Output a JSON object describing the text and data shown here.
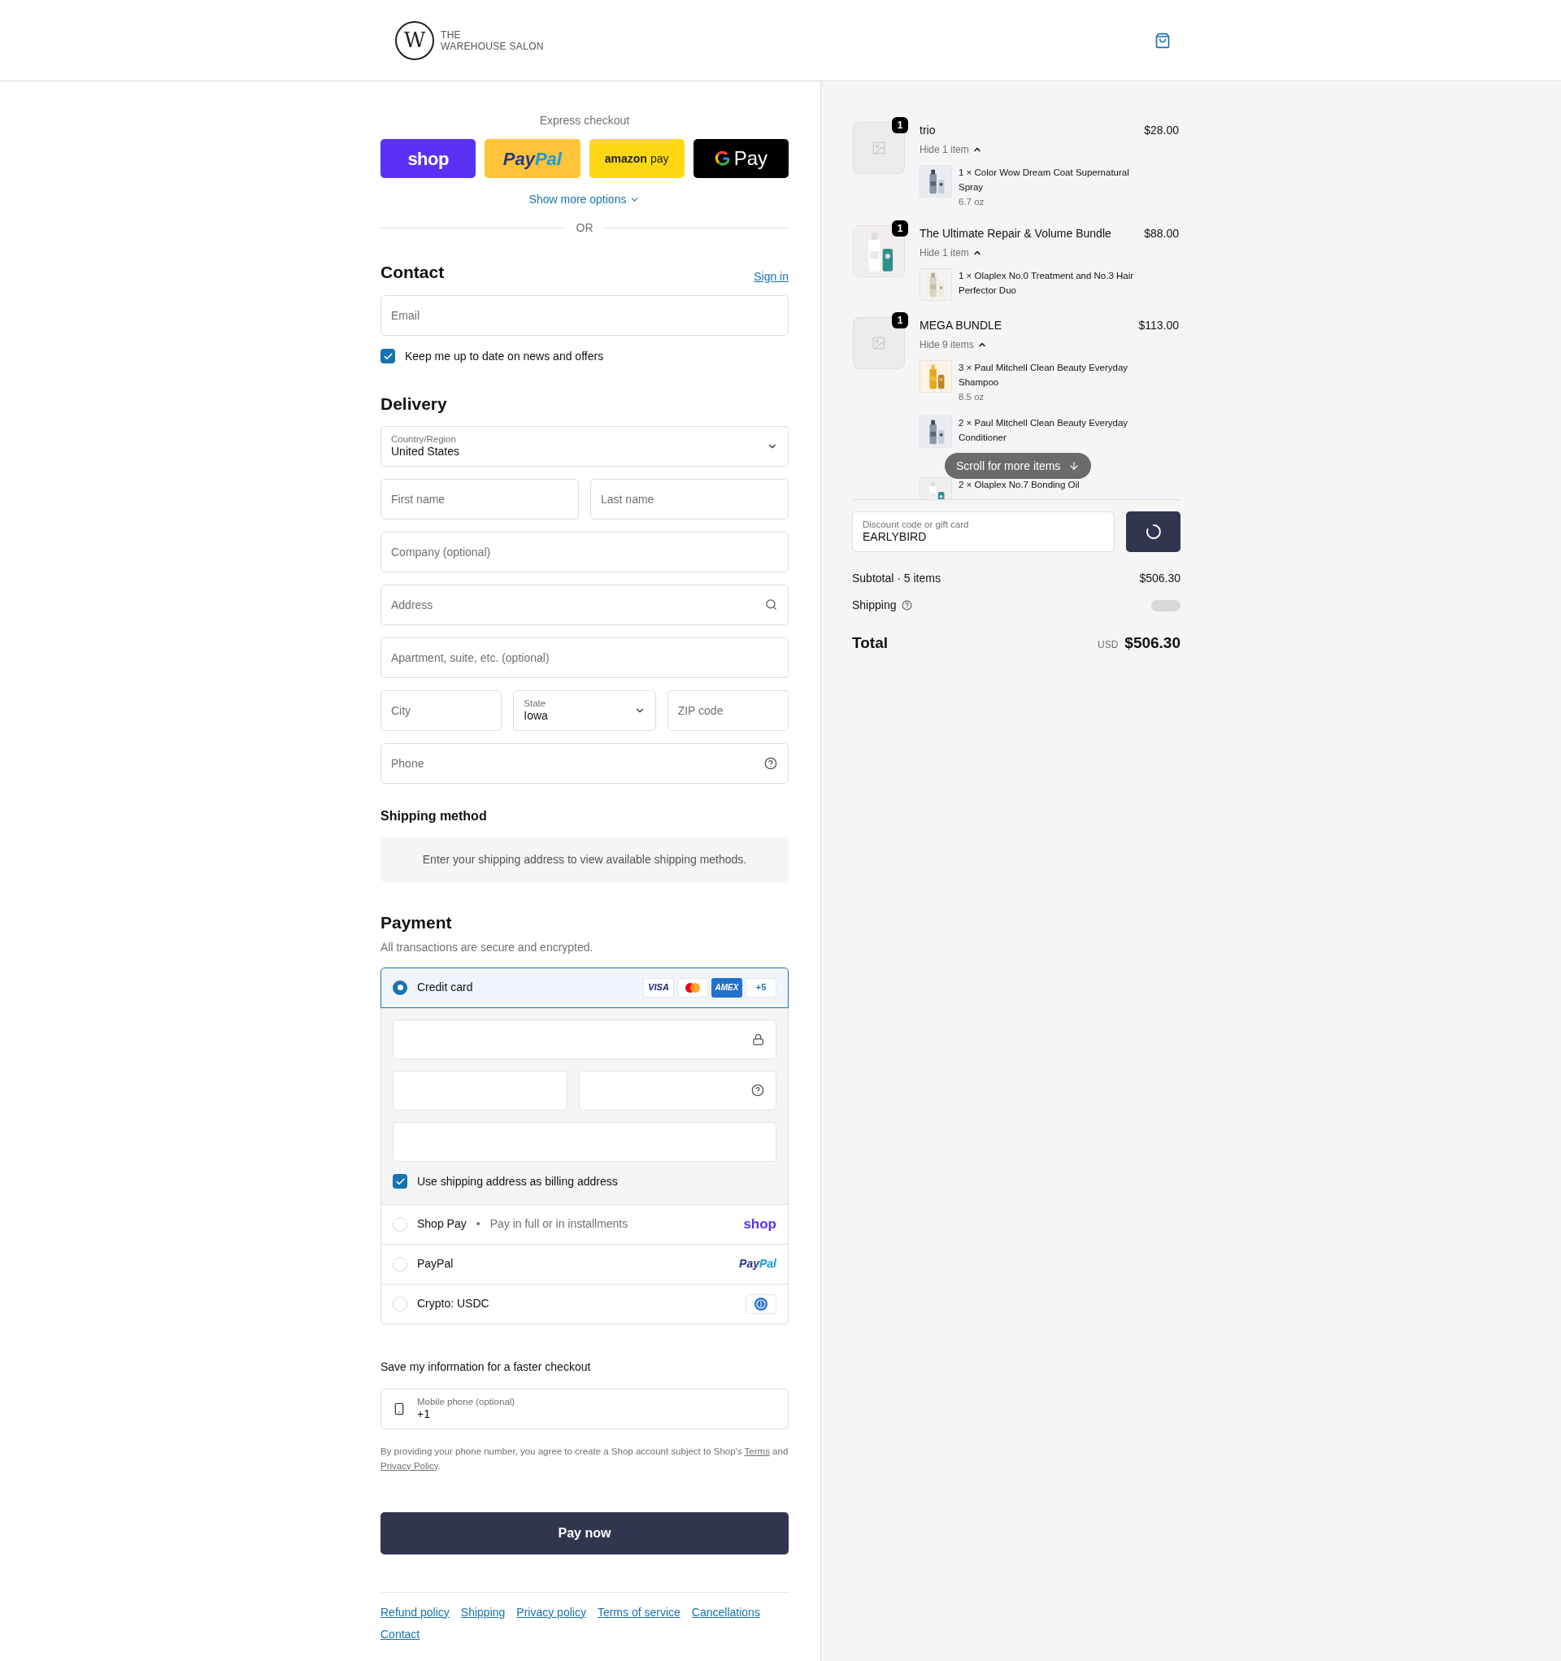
{
  "header": {
    "logo_letter": "W",
    "brand_line_1": "THE",
    "brand_line_2": "WAREHOUSE SALON"
  },
  "express": {
    "title": "Express checkout",
    "buttons": [
      {
        "kind": "shop",
        "label": "shop"
      },
      {
        "kind": "paypal",
        "label_1": "Pay",
        "label_2": "Pal"
      },
      {
        "kind": "amazon",
        "label_1": "amazon",
        "label_2": "pay"
      },
      {
        "kind": "gpay",
        "label": "Pay"
      }
    ],
    "more": "Show more options",
    "divider": "OR"
  },
  "contact": {
    "title": "Contact",
    "sign_in": "Sign in",
    "email": {
      "placeholder": "Email"
    },
    "news": {
      "label": "Keep me up to date on news and offers",
      "checked": true
    }
  },
  "delivery": {
    "title": "Delivery",
    "rows": [
      [
        {
          "kind": "select",
          "label": "Country/Region",
          "value": "United States"
        }
      ],
      [
        {
          "kind": "text",
          "placeholder": "First name"
        },
        {
          "kind": "text",
          "placeholder": "Last name"
        }
      ],
      [
        {
          "kind": "text",
          "placeholder": "Company (optional)"
        }
      ],
      [
        {
          "kind": "search",
          "placeholder": "Address"
        }
      ],
      [
        {
          "kind": "text",
          "placeholder": "Apartment, suite, etc. (optional)"
        }
      ],
      [
        {
          "kind": "text",
          "placeholder": "City"
        },
        {
          "kind": "select",
          "label": "State",
          "value": "Iowa"
        },
        {
          "kind": "text",
          "placeholder": "ZIP code"
        }
      ],
      [
        {
          "kind": "help",
          "placeholder": "Phone"
        }
      ]
    ]
  },
  "shipping_method": {
    "title": "Shipping method",
    "notice": "Enter your shipping address to view available shipping methods."
  },
  "payment": {
    "title": "Payment",
    "subtitle": "All transactions are secure and encrypted.",
    "methods": [
      {
        "kind": "card",
        "label": "Credit card",
        "selected": true,
        "brands": [
          {
            "kind": "visa",
            "label": "VISA"
          },
          {
            "kind": "mastercard"
          },
          {
            "kind": "amex",
            "label": "AMEX"
          }
        ],
        "more": "+5",
        "billing": {
          "label": "Use shipping address as billing address",
          "checked": true
        }
      },
      {
        "kind": "shop_pay",
        "label": "Shop Pay",
        "separator": "•",
        "note": "Pay in full or in installments",
        "logo": "shop",
        "selected": false
      },
      {
        "kind": "paypal",
        "label": "PayPal",
        "logo_1": "Pay",
        "logo_2": "Pal",
        "selected": false
      },
      {
        "kind": "crypto",
        "label": "Crypto: USDC",
        "selected": false
      }
    ]
  },
  "save": {
    "title": "Save my information for a faster checkout",
    "phone": {
      "label": "Mobile phone (optional)",
      "value": "+1"
    },
    "legal_1": "By providing your phone number, you agree to create a Shop account subject to Shop's",
    "terms": "Terms",
    "legal_2": "and",
    "privacy": "Privacy Policy",
    "legal_3": "."
  },
  "pay_button": "Pay now",
  "footer_links": [
    "Refund policy",
    "Shipping",
    "Privacy policy",
    "Terms of service",
    "Cancellations",
    "Contact"
  ],
  "summary": {
    "items": [
      {
        "name": "trio",
        "price": "$28.00",
        "quantity": "1",
        "kind": "placeholder",
        "toggle": "Hide 1 item",
        "expanded": true,
        "children": [
          {
            "text": "1 × Color Wow Dream Coat Supernatural Spray",
            "variant": "6.7 oz"
          }
        ]
      },
      {
        "name": "The Ultimate Repair & Volume Bundle",
        "price": "$88.00",
        "quantity": "1",
        "kind": "picture",
        "toggle": "Hide 1 item",
        "expanded": true,
        "children": [
          {
            "text": "1 × Olaplex No.0 Treatment and No.3 Hair Perfector Duo"
          }
        ]
      },
      {
        "name": "MEGA BUNDLE",
        "price": "$113.00",
        "quantity": "1",
        "kind": "placeholder",
        "toggle": "Hide 9 items",
        "expanded": true,
        "children": [
          {
            "text": "3 × Paul Mitchell Clean Beauty Everyday Shampoo",
            "variant": "8.5 oz"
          },
          {
            "text": "2 × Paul Mitchell Clean Beauty Everyday Conditioner"
          },
          {
            "text": "2 × Olaplex No.7 Bonding Oil"
          }
        ]
      }
    ],
    "scroll_hint": "Scroll for more items",
    "discount": {
      "label": "Discount code or gift card",
      "value": "EARLYBIRD"
    },
    "subtotal_label": "Subtotal · 5 items",
    "subtotal": "$506.30",
    "shipping_label": "Shipping",
    "total_label": "Total",
    "currency": "USD",
    "total": "$506.30"
  }
}
